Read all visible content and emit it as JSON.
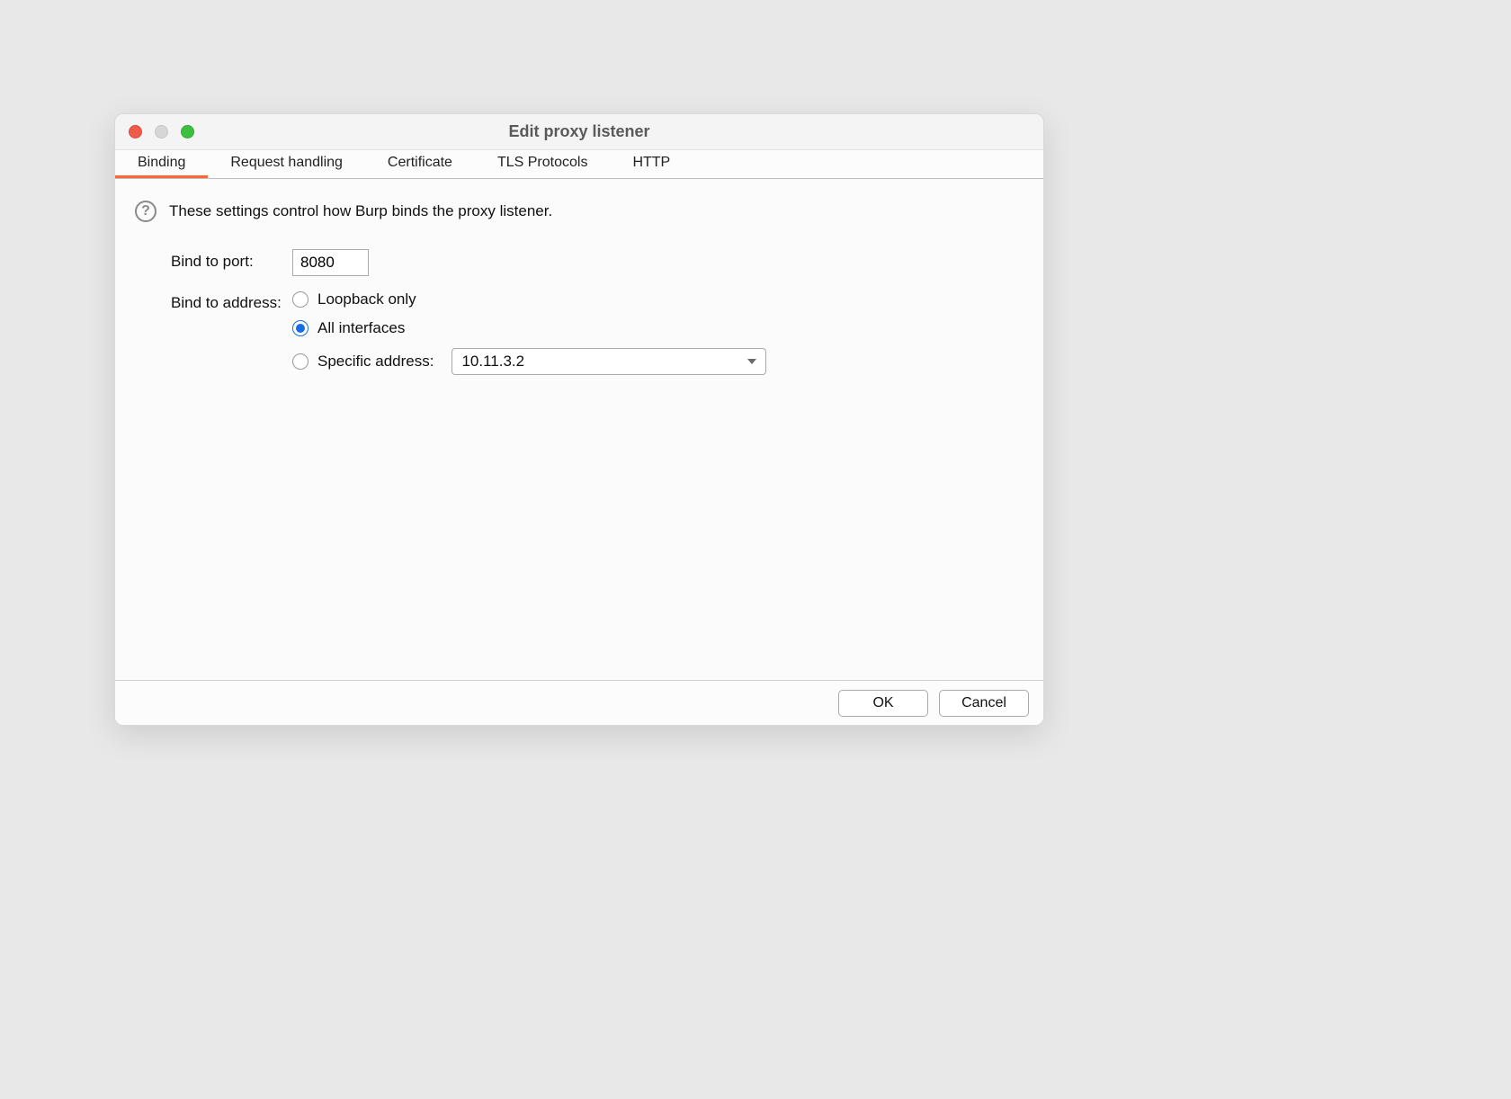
{
  "window": {
    "title": "Edit proxy listener"
  },
  "tabs": [
    {
      "label": "Binding",
      "active": true
    },
    {
      "label": "Request handling",
      "active": false
    },
    {
      "label": "Certificate",
      "active": false
    },
    {
      "label": "TLS Protocols",
      "active": false
    },
    {
      "label": "HTTP",
      "active": false
    }
  ],
  "binding": {
    "description": "These settings control how Burp binds the proxy listener.",
    "port_label": "Bind to port:",
    "port_value": "8080",
    "address_label": "Bind to address:",
    "options": [
      {
        "id": "loopback",
        "label": "Loopback only",
        "selected": false
      },
      {
        "id": "all",
        "label": "All interfaces",
        "selected": true
      },
      {
        "id": "specific",
        "label": "Specific address:",
        "selected": false
      }
    ],
    "specific_address_value": "10.11.3.2"
  },
  "buttons": {
    "ok": "OK",
    "cancel": "Cancel"
  },
  "help_glyph": "?"
}
